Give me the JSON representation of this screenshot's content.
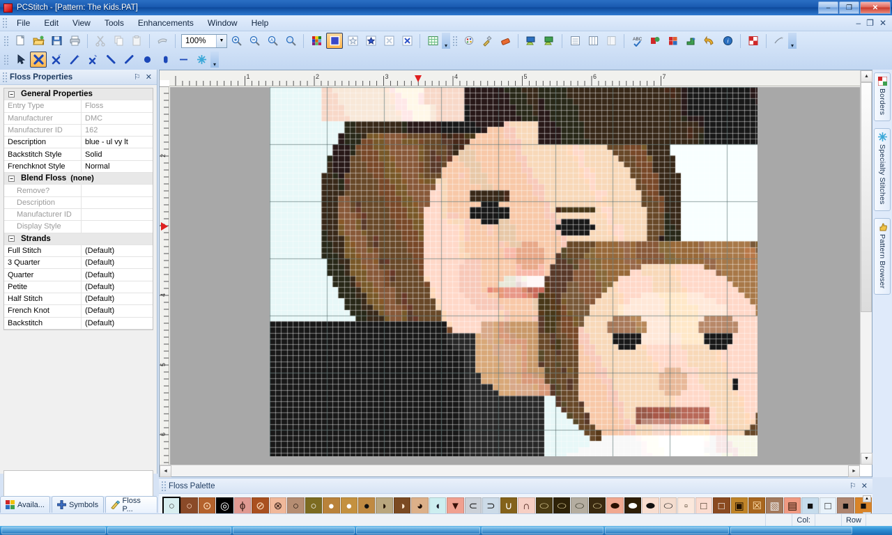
{
  "titlebar": {
    "title": "PCStitch - [Pattern: The Kids.PAT]",
    "minimize": "–",
    "restore": "❐",
    "close": "✕"
  },
  "menubar": {
    "items": [
      "File",
      "Edit",
      "View",
      "Tools",
      "Enhancements",
      "Window",
      "Help"
    ],
    "win_minimize": "–",
    "win_restore": "❐",
    "win_close": "✕"
  },
  "toolbar": {
    "zoom_value": "100%",
    "row1_icons": [
      "new-document-icon",
      "open-folder-icon",
      "save-disk-icon",
      "print-icon",
      "cut-scissors-icon",
      "copy-icon",
      "paste-icon",
      "format-painter-icon"
    ],
    "row1b_icons": [
      "zoom-in-icon",
      "zoom-out-icon",
      "zoom-actual-icon",
      "zoom-selection-icon",
      "color-palette-icon",
      "full-stitch-icon",
      "quarter-stitch-icon",
      "three-quarter-stitch-icon",
      "half-stitch-icon",
      "cross-stitch-icon",
      "grid-icon"
    ],
    "row1c_icons": [
      "paint-swatch-icon",
      "eyedropper-icon",
      "eraser-icon",
      "import-photo-icon",
      "export-photo-icon",
      "list-view-icon",
      "column-view-icon",
      "page-view-icon",
      "spellcheck-icon",
      "pattern-colors-icon",
      "floss-chart-icon",
      "backstitch-icon",
      "undo-arrow-icon",
      "info-icon",
      "borders-icon",
      "stitch-tool-icon"
    ],
    "row2_icons": [
      "pointer-icon",
      "cross-stitch-tool-icon",
      "half-stitch-tool-icon",
      "magic-wand-icon",
      "quarter-stitch-tool-icon",
      "backstitch-line-icon",
      "straight-line-icon",
      "french-knot-icon",
      "bead-icon",
      "dash-line-icon",
      "specialty-star-icon"
    ],
    "overflow": "▾"
  },
  "floss_properties": {
    "panel_title": "Floss Properties",
    "pin_icon": "⚐",
    "close_icon": "✕",
    "groups": [
      {
        "name": "General Properties",
        "expander": "−",
        "rows": [
          {
            "label": "Entry Type",
            "value": "Floss",
            "dim": true,
            "indent": false
          },
          {
            "label": "Manufacturer",
            "value": "DMC",
            "dim": true,
            "indent": false
          },
          {
            "label": "Manufacturer ID",
            "value": "162",
            "dim": true,
            "indent": false
          },
          {
            "label": "Description",
            "value": "blue - ul vy lt",
            "dim": false,
            "indent": false
          },
          {
            "label": "Backstitch Style",
            "value": "Solid",
            "dim": false,
            "indent": false
          },
          {
            "label": "Frenchknot Style",
            "value": "Normal",
            "dim": false,
            "indent": false
          }
        ]
      },
      {
        "name": "Blend Floss",
        "expander": "−",
        "inline_value": "(none)",
        "rows": [
          {
            "label": "Remove?",
            "value": "",
            "dim": true,
            "indent": true
          },
          {
            "label": "Description",
            "value": "",
            "dim": true,
            "indent": true
          },
          {
            "label": "Manufacturer ID",
            "value": "",
            "dim": true,
            "indent": true
          },
          {
            "label": "Display Style",
            "value": "",
            "dim": true,
            "indent": true
          }
        ]
      },
      {
        "name": "Strands",
        "expander": "−",
        "rows": [
          {
            "label": "Full Stitch",
            "value": "(Default)",
            "dim": false,
            "indent": false
          },
          {
            "label": "3 Quarter",
            "value": "(Default)",
            "dim": false,
            "indent": false
          },
          {
            "label": "Quarter",
            "value": "(Default)",
            "dim": false,
            "indent": false
          },
          {
            "label": "Petite",
            "value": "(Default)",
            "dim": false,
            "indent": false
          },
          {
            "label": "Half Stitch",
            "value": "(Default)",
            "dim": false,
            "indent": false
          },
          {
            "label": "French Knot",
            "value": "(Default)",
            "dim": false,
            "indent": false
          },
          {
            "label": "Backstitch",
            "value": "(Default)",
            "dim": false,
            "indent": false
          }
        ]
      }
    ]
  },
  "left_tabs": [
    {
      "label": "Availa...",
      "icon": "color-grid-icon",
      "active": false
    },
    {
      "label": "Symbols",
      "icon": "plus-cross-icon",
      "active": false
    },
    {
      "label": "Floss P...",
      "icon": "pencil-icon",
      "active": true
    }
  ],
  "right_tabs": [
    {
      "label": "Borders",
      "icon": "borders-icon"
    },
    {
      "label": "Specialty Stitches",
      "icon": "asterisk-star-icon"
    },
    {
      "label": "Pattern Browser",
      "icon": "thumbs-up-icon"
    }
  ],
  "canvas": {
    "h_ruler_labels": [
      "1",
      "2",
      "3",
      "4",
      "5",
      "6",
      "7"
    ],
    "v_ruler_labels": [
      "2",
      "3",
      "4",
      "5",
      "6"
    ],
    "h_marker_position": "3.5",
    "v_marker_position": "3.4",
    "marker_icon": "red-triangle-marker",
    "scroll_up": "▲",
    "scroll_down": "▼",
    "scroll_left": "◄",
    "scroll_right": "►"
  },
  "floss_palette": {
    "panel_title": "Floss Palette",
    "pin_icon": "⚐",
    "close_icon": "✕",
    "scroll_up": "▲",
    "scroll_down": "▼",
    "selected_index": 0,
    "swatches": [
      {
        "bg": "#d8eef0",
        "fg": "#4a4a4a",
        "symbol": "○"
      },
      {
        "bg": "#8a4a28",
        "fg": "#ffd9c0",
        "symbol": "○"
      },
      {
        "bg": "#b4622c",
        "fg": "#ffe4c4",
        "symbol": "⊙"
      },
      {
        "bg": "#000000",
        "fg": "#ffffff",
        "symbol": "◎"
      },
      {
        "bg": "#e09a92",
        "fg": "#3a2018",
        "symbol": "ϕ"
      },
      {
        "bg": "#a9501f",
        "fg": "#ffe0c0",
        "symbol": "⊘"
      },
      {
        "bg": "#f0b89a",
        "fg": "#3a2018",
        "symbol": "⊗"
      },
      {
        "bg": "#b58d72",
        "fg": "#1a0f08",
        "symbol": "○"
      },
      {
        "bg": "#7c6b20",
        "fg": "#ffffff",
        "symbol": "○"
      },
      {
        "bg": "#b9823a",
        "fg": "#ffffff",
        "symbol": "●"
      },
      {
        "bg": "#c4913f",
        "fg": "#ffffff",
        "symbol": "●"
      },
      {
        "bg": "#c08a42",
        "fg": "#111111",
        "symbol": "●"
      },
      {
        "bg": "#b9a67e",
        "fg": "#221100",
        "symbol": "◗"
      },
      {
        "bg": "#7b4a22",
        "fg": "#ffe8d0",
        "symbol": "◑"
      },
      {
        "bg": "#dcb089",
        "fg": "#1a0a00",
        "symbol": "◕"
      },
      {
        "bg": "#cdeef0",
        "fg": "#1a1a2a",
        "symbol": "◖"
      },
      {
        "bg": "#f0a090",
        "fg": "#3a1008",
        "symbol": "▼"
      },
      {
        "bg": "#ccd1d8",
        "fg": "#1a1a1a",
        "symbol": "⊂"
      },
      {
        "bg": "#ccdbe8",
        "fg": "#1a1a1a",
        "symbol": "⊃"
      },
      {
        "bg": "#84621a",
        "fg": "#ffffff",
        "symbol": "∪"
      },
      {
        "bg": "#f6cfc4",
        "fg": "#3a1008",
        "symbol": "∩"
      },
      {
        "bg": "#4a3a12",
        "fg": "#e8d8a0",
        "symbol": "⬭"
      },
      {
        "bg": "#2e2208",
        "fg": "#e8d8a0",
        "symbol": "⬭"
      },
      {
        "bg": "#b4ada0",
        "fg": "#2a2a1a",
        "symbol": "⬭"
      },
      {
        "bg": "#3a2a10",
        "fg": "#e8d8a0",
        "symbol": "⬭"
      },
      {
        "bg": "#f0a890",
        "fg": "#2a1000",
        "symbol": "⬬"
      },
      {
        "bg": "#2e1e06",
        "fg": "#ffffff",
        "symbol": "⬬"
      },
      {
        "bg": "#f8ded0",
        "fg": "#111111",
        "symbol": "⬬"
      },
      {
        "bg": "#f4ddcf",
        "fg": "#111111",
        "symbol": "⬭"
      },
      {
        "bg": "#fbe8dc",
        "fg": "#3a2a18",
        "symbol": "▫"
      },
      {
        "bg": "#fbdcd0",
        "fg": "#3a2a18",
        "symbol": "□"
      },
      {
        "bg": "#8a4a20",
        "fg": "#ffffff",
        "symbol": "□"
      },
      {
        "bg": "#c08428",
        "fg": "#221100",
        "symbol": "▣"
      },
      {
        "bg": "#a8661e",
        "fg": "#ffe0b0",
        "symbol": "☒"
      },
      {
        "bg": "#a3795c",
        "fg": "#eeeeee",
        "symbol": "▧"
      },
      {
        "bg": "#f09a82",
        "fg": "#2a1000",
        "symbol": "▤"
      },
      {
        "bg": "#c6dcec",
        "fg": "#111111",
        "symbol": "■"
      },
      {
        "bg": "#e8f2fa",
        "fg": "#111111",
        "symbol": "□"
      },
      {
        "bg": "#ae8570",
        "fg": "#111111",
        "symbol": "■"
      },
      {
        "bg": "#d98428",
        "fg": "#111111",
        "symbol": "■"
      }
    ]
  },
  "statusbar": {
    "col_label": "Col:",
    "col_value": "",
    "row_label": "Row",
    "row_value": ""
  }
}
